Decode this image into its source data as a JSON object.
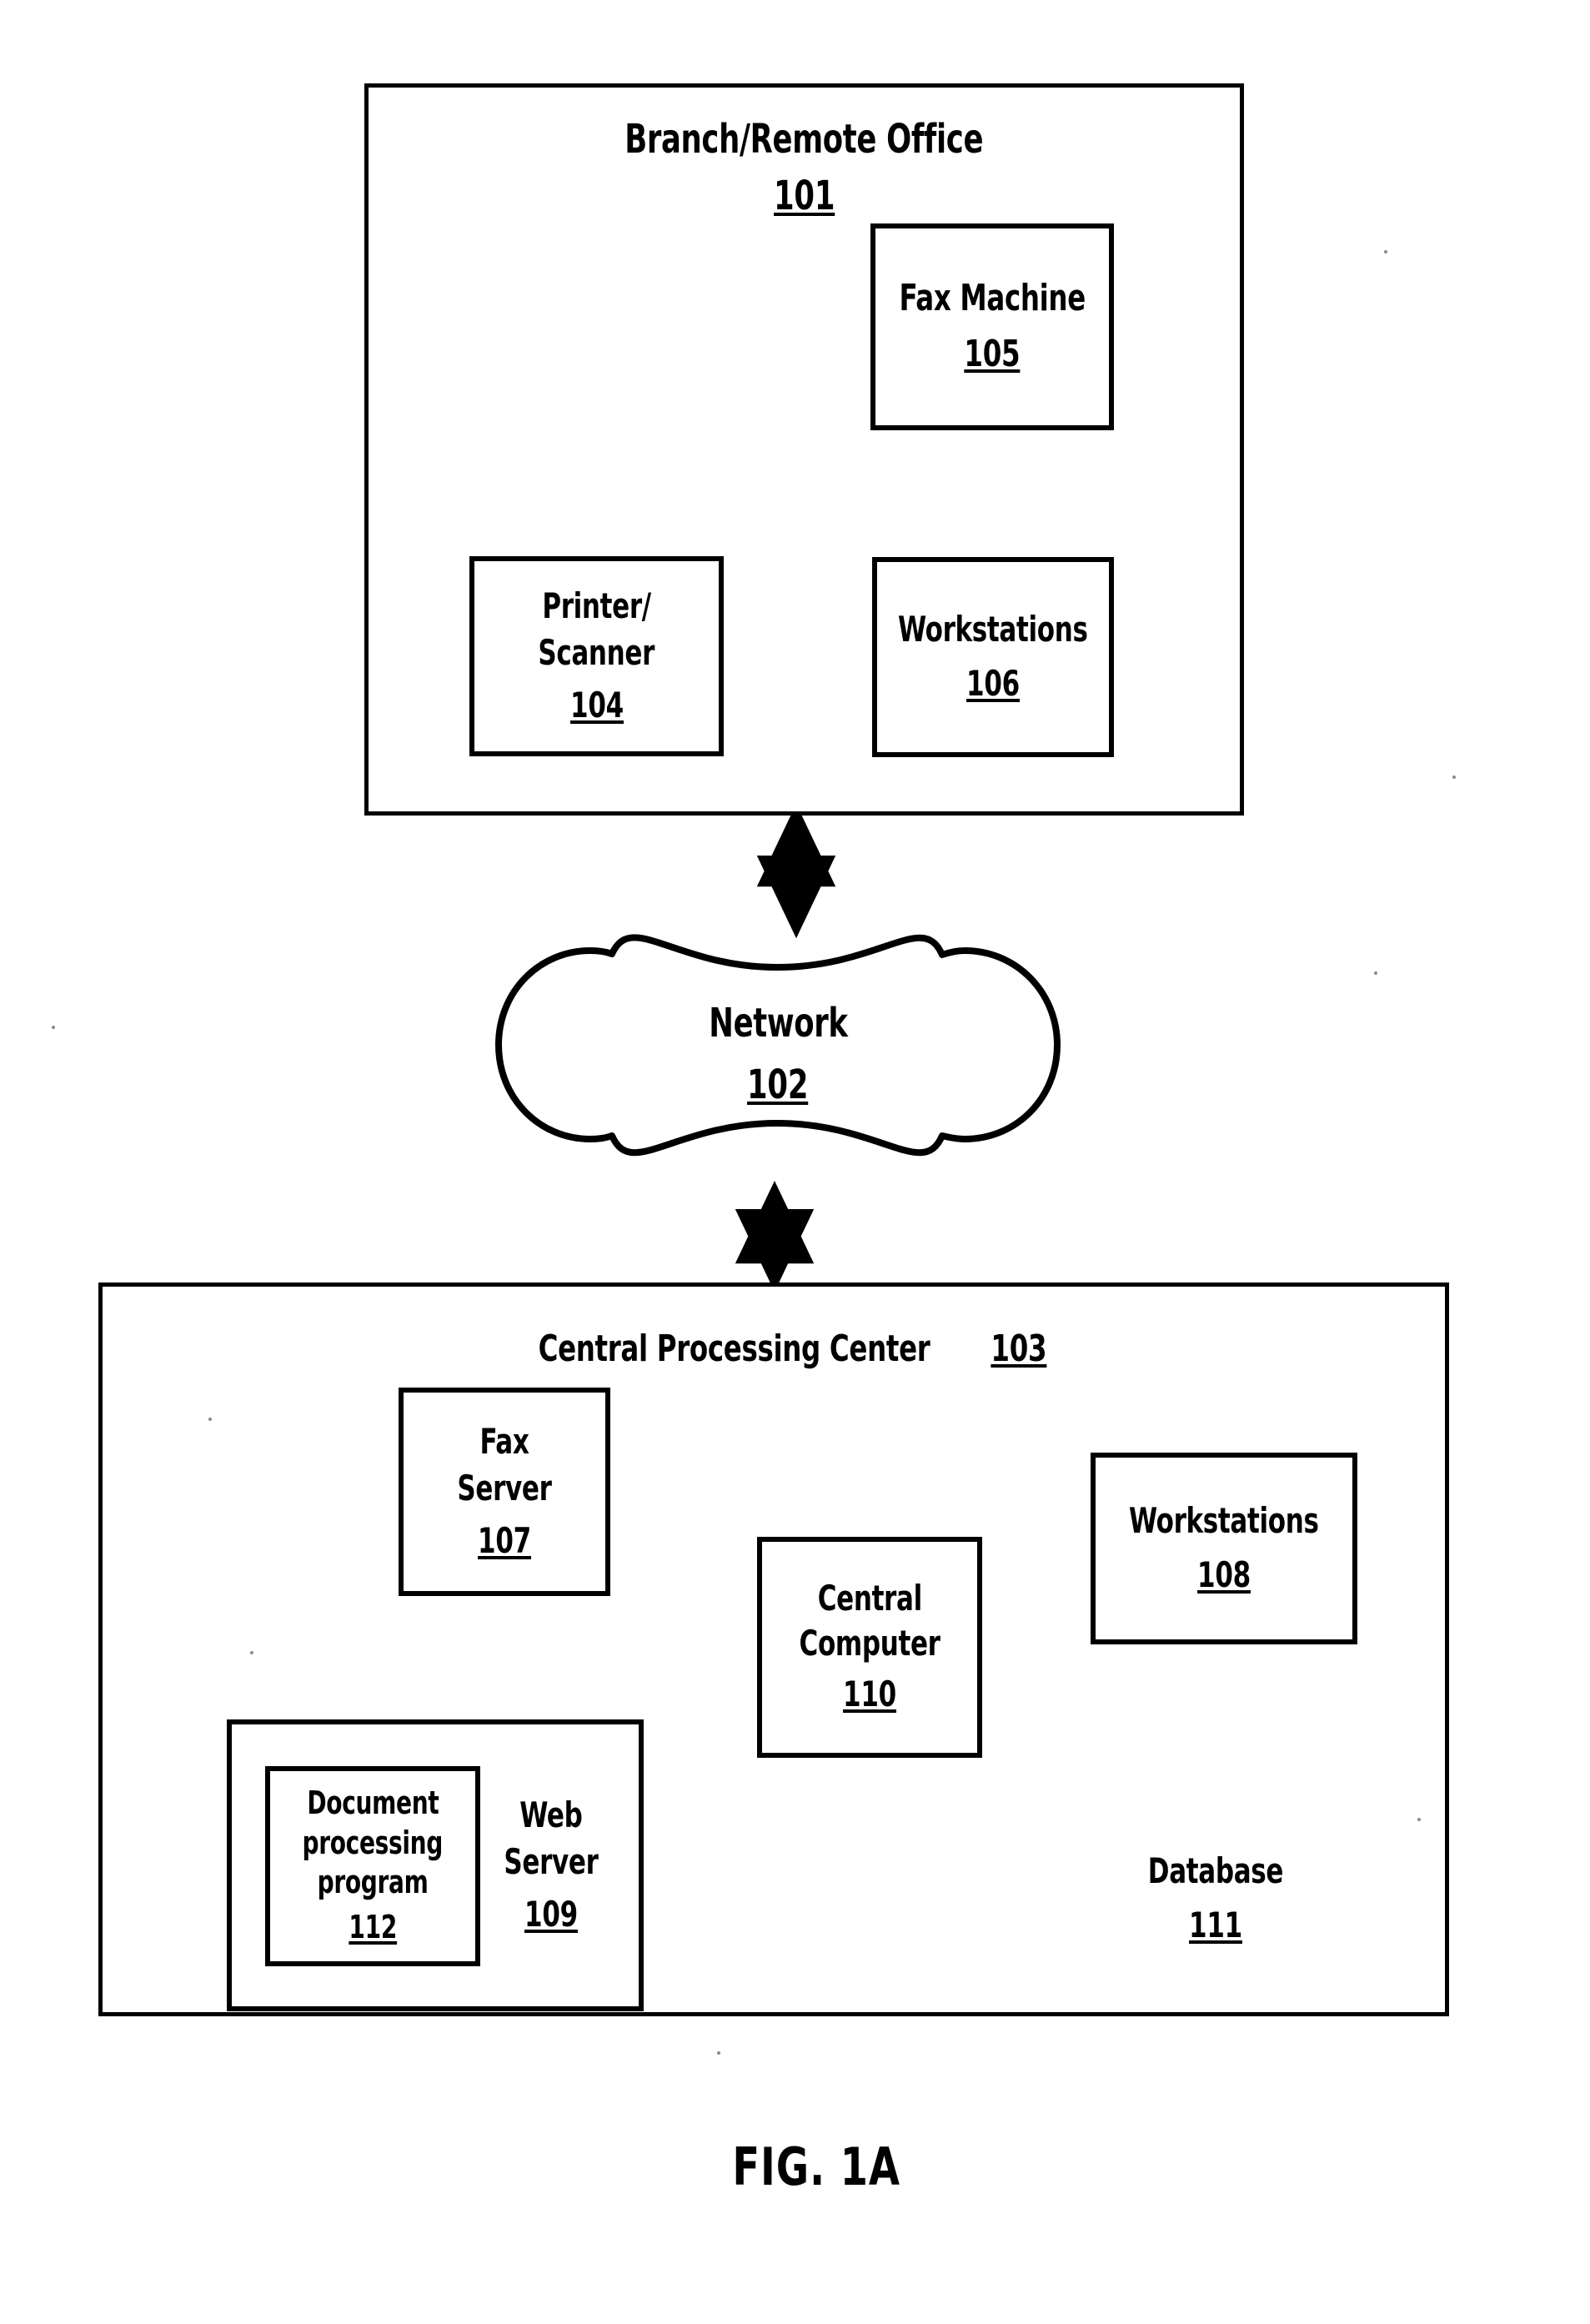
{
  "figure": {
    "caption": "FIG. 1A",
    "background_color": "#ffffff",
    "line_color": "#000000"
  },
  "branch_office": {
    "title": "Branch/Remote  Office",
    "ref": "101",
    "nodes": [
      {
        "key": "fax_machine",
        "label": "Fax Machine",
        "ref": "105"
      },
      {
        "key": "printer_scanner",
        "label_line1": "Printer/",
        "label_line2": "Scanner",
        "ref": "104"
      },
      {
        "key": "workstations",
        "label": "Workstations",
        "ref": "106"
      }
    ]
  },
  "network": {
    "label": "Network",
    "ref": "102"
  },
  "central_processing_center": {
    "title": "Central Processing Center",
    "ref": "103",
    "nodes": [
      {
        "key": "fax_server",
        "label_line1": "Fax",
        "label_line2": "Server",
        "ref": "107"
      },
      {
        "key": "central_computer",
        "label_line1": "Central",
        "label_line2": "Computer",
        "ref": "110"
      },
      {
        "key": "workstations",
        "label": "Workstations",
        "ref": "108"
      },
      {
        "key": "web_server",
        "label_line1": "Web",
        "label_line2": "Server",
        "ref": "109"
      },
      {
        "key": "doc_program",
        "label_line1": "Document",
        "label_line2": "processing",
        "label_line3": "program",
        "ref": "112"
      },
      {
        "key": "database",
        "label": "Database",
        "ref": "111"
      }
    ]
  },
  "connections": [
    {
      "from": "fax_machine",
      "to": "workstations_106",
      "kind": "double-arrow"
    },
    {
      "from": "printer_scanner",
      "to": "workstations_106",
      "kind": "double-arrow"
    },
    {
      "from": "branch_office_101",
      "to": "network_102",
      "kind": "double-arrow"
    },
    {
      "from": "network_102",
      "to": "central_center_103",
      "kind": "double-arrow"
    },
    {
      "from": "central_computer",
      "to": "fax_server",
      "kind": "arrow"
    },
    {
      "from": "fax_server",
      "to": "central_computer",
      "kind": "arrow"
    },
    {
      "from": "central_computer",
      "to": "workstations_108",
      "kind": "arrow"
    },
    {
      "from": "workstations_108",
      "to": "central_computer",
      "kind": "arrow"
    },
    {
      "from": "central_computer",
      "to": "database",
      "kind": "arrow"
    },
    {
      "from": "central_computer",
      "to": "web_server",
      "kind": "arrow"
    },
    {
      "from": "web_server",
      "to": "central_computer",
      "kind": "arrow"
    }
  ]
}
